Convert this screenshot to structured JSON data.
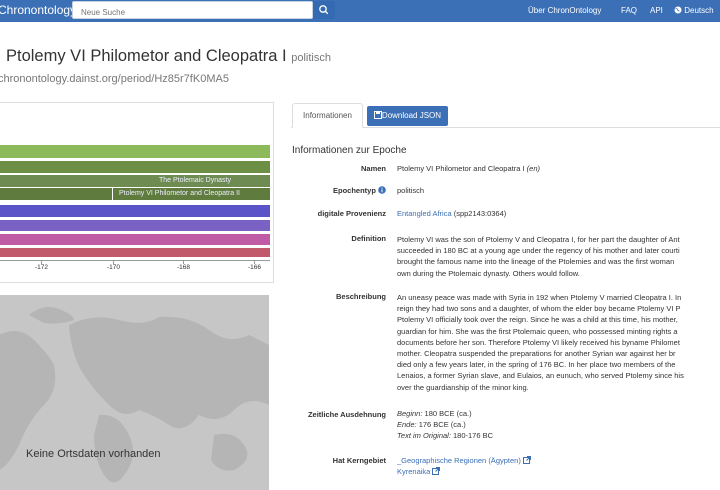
{
  "navbar": {
    "brand": "Chronontology",
    "search_placeholder": "Neue Suche",
    "links": [
      "Über ChronOntology",
      "FAQ",
      "API"
    ],
    "language": "Deutsch"
  },
  "header": {
    "title": "Ptolemy VI Philometor and Cleopatra I",
    "type_badge": "politisch",
    "uri": "chronontology.dainst.org/period/Hz85r7fK0MA5"
  },
  "timeline": {
    "bars": [
      {
        "color": "#8cba5a",
        "label": ""
      },
      {
        "color": "#6d8f45",
        "label": ""
      },
      {
        "color": "#6e8c52",
        "label": "The Ptolemaic Dynasty"
      },
      {
        "color": "#5f7b3e",
        "label": "Ptolemy VI Philometor and Cleopatra II"
      },
      {
        "color": "#5a54c8",
        "label": ""
      },
      {
        "color": "#7a62c4",
        "label": ""
      },
      {
        "color": "#c05ca6",
        "label": ""
      },
      {
        "color": "#c15a6a",
        "label": ""
      }
    ],
    "ticks": [
      "-172",
      "-170",
      "-168",
      "-166"
    ]
  },
  "map": {
    "message": "Keine Ortsdaten vorhanden"
  },
  "tabs": {
    "info": "Informationen",
    "download": "Download JSON"
  },
  "details": {
    "section_title": "Informationen zur Epoche",
    "labels": {
      "names": "Namen",
      "epoch_type": "Epochentyp",
      "provenance": "digitale Provenienz",
      "definition": "Definition",
      "description": "Beschreibung",
      "time_extent": "Zeitliche Ausdehnung",
      "core_area": "Hat Kerngebiet"
    },
    "names_value": "Ptolemy VI Philometor and Cleopatra I",
    "names_lang": "(en)",
    "epoch_type_value": "politisch",
    "provenance_link": "Entangled Africa",
    "provenance_id": "(spp2143:0364)",
    "definition_lines": [
      "Ptolemy VI was the son of Ptolemy V and Cleopatra I, for her part the daughter of Ant",
      "succeeded in 180 BC at a young age under the regency of his mother and later courti",
      "brought the famous name into the lineage of the Ptolemies and was the first woman",
      "own during the Ptolemaic dynasty. Others would follow."
    ],
    "description_lines": [
      "An uneasy peace was made with Syria in 192 when Ptolemy V married Cleopatra I. In",
      "reign they had two sons and a daughter, of whom the elder boy became Ptolemy VI P",
      "Ptolemy VI officially took over the reign. Since he was a child at this time, his mother,",
      "guardian for him. She was the first Ptolemaic queen, who possessed minting rights a",
      "documents before her son. Therefore Ptolemy VI likely received his byname Philomet",
      "mother. Cleopatra suspended the preparations for another Syrian war against her br",
      "died only a few years later, in the spring of 176 BC. In her place two members of the",
      "Lenaios, a former Syrian slave, and Eulaios, an eunuch, who served Ptolemy since his",
      "over the guardianship of the minor king."
    ],
    "time_extent": {
      "begin_label": "Beginn:",
      "begin_value": "180 BCE (ca.)",
      "end_label": "Ende:",
      "end_value": "176 BCE (ca.)",
      "original_label": "Text im Original:",
      "original_value": "180-176 BC"
    },
    "core_area_links": [
      "_Geographische Regionen (Ägypten)",
      "Kyrenaika"
    ]
  },
  "colors": {
    "nav_bg": "#3b6fb6",
    "link": "#3b6fb6",
    "map_bg": "#c4c4c4"
  }
}
